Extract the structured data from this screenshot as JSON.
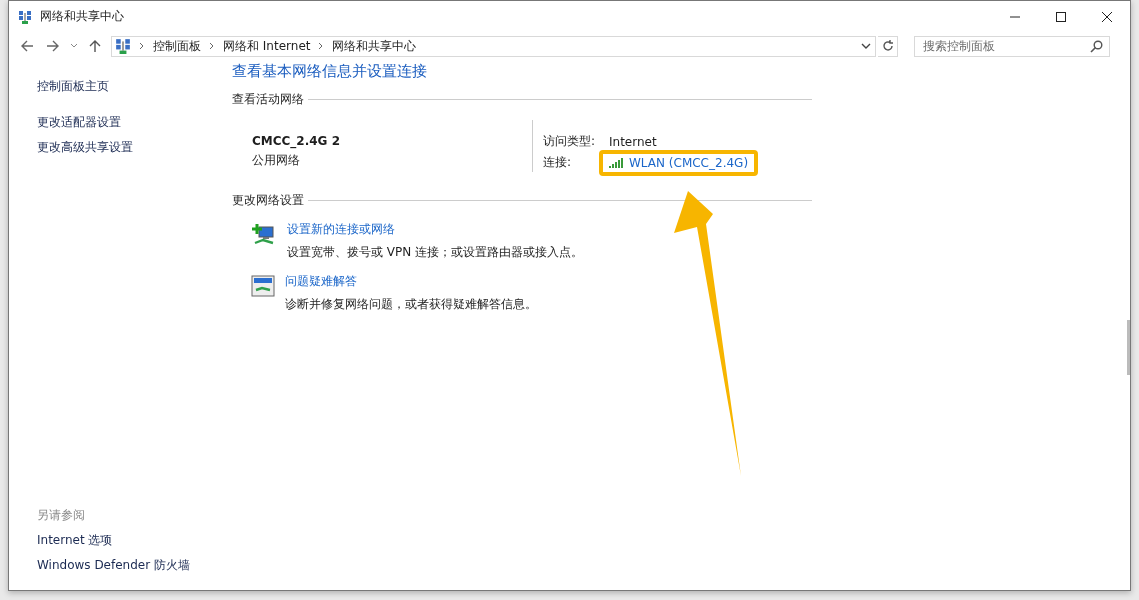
{
  "window": {
    "title": "网络和共享中心"
  },
  "address_bar": {
    "breadcrumbs": [
      "控制面板",
      "网络和 Internet",
      "网络和共享中心"
    ]
  },
  "search": {
    "placeholder": "搜索控制面板"
  },
  "sidebar": {
    "items": [
      "控制面板主页",
      "更改适配器设置",
      "更改高级共享设置"
    ],
    "see_also_heading": "另请参阅",
    "see_also": [
      "Internet 选项",
      "Windows Defender 防火墙"
    ]
  },
  "main": {
    "heading": "查看基本网络信息并设置连接",
    "active_networks_heading": "查看活动网络",
    "network": {
      "name": "CMCC_2.4G 2",
      "category": "公用网络",
      "access_type_label": "访问类型:",
      "access_type": "Internet",
      "connection_label": "连接:",
      "connection": "WLAN (CMCC_2.4G)",
      "highlighted": true
    },
    "settings_heading": "更改网络设置",
    "tasks": [
      {
        "kind": "new-connection",
        "title": "设置新的连接或网络",
        "description": "设置宽带、拨号或 VPN 连接；或设置路由器或接入点。"
      },
      {
        "kind": "troubleshoot",
        "title": "问题疑难解答",
        "description": "诊断并修复网络问题，或者获得疑难解答信息。"
      }
    ]
  }
}
